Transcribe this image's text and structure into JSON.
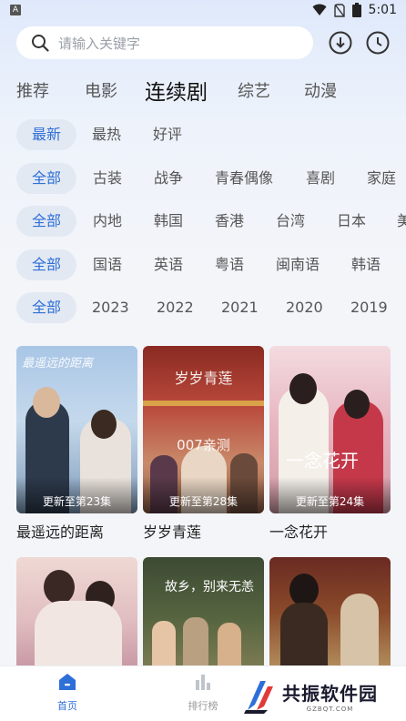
{
  "status_bar": {
    "app_badge": "A",
    "time": "5:01"
  },
  "search": {
    "placeholder": "请输入关键字"
  },
  "tabs": [
    {
      "label": "推荐"
    },
    {
      "label": "电影"
    },
    {
      "label": "连续剧",
      "active": true
    },
    {
      "label": "综艺"
    },
    {
      "label": "动漫"
    }
  ],
  "filters": {
    "sort": [
      "最新",
      "最热",
      "好评"
    ],
    "genre": [
      "全部",
      "古装",
      "战争",
      "青春偶像",
      "喜剧",
      "家庭"
    ],
    "region": [
      "全部",
      "内地",
      "韩国",
      "香港",
      "台湾",
      "日本",
      "美"
    ],
    "language": [
      "全部",
      "国语",
      "英语",
      "粤语",
      "闽南语",
      "韩语"
    ],
    "year": [
      "全部",
      "2023",
      "2022",
      "2021",
      "2020",
      "2019"
    ]
  },
  "shows": [
    {
      "title": "最遥远的距离",
      "update": "更新至第23集",
      "art": "最遥远的距离"
    },
    {
      "title": "岁岁青莲",
      "update": "更新至第28集",
      "art": "岁岁青莲",
      "watermark": "007亲测"
    },
    {
      "title": "一念花开",
      "update": "更新至第24集",
      "art": "一念花开"
    },
    {
      "title": "",
      "update": "",
      "art": ""
    },
    {
      "title": "",
      "update": "",
      "art": "故乡，别来无恙"
    },
    {
      "title": "",
      "update": "",
      "art": ""
    }
  ],
  "nav": {
    "home": "首页",
    "ranking": "排行榜"
  },
  "brand": {
    "name": "共振软件园",
    "domain": "GZBQT.COM"
  },
  "colors": {
    "accent": "#2e6fd8",
    "chip_bg": "#e3e9f2",
    "nav_active": "#2e6fd8"
  }
}
